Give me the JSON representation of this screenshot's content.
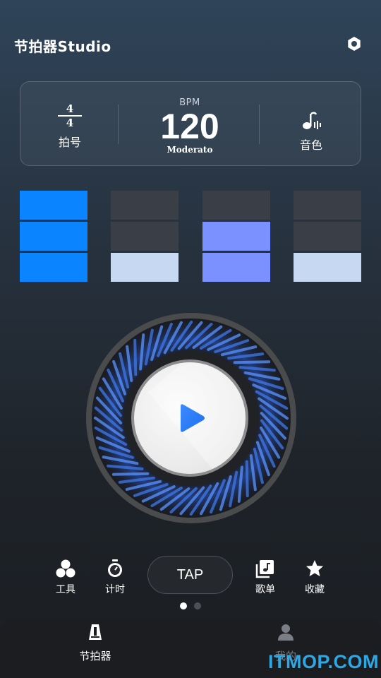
{
  "header": {
    "title": "节拍器Studio",
    "settings_icon": "gear-icon"
  },
  "panel": {
    "beat": {
      "numerator": "4",
      "denominator": "4",
      "label": "拍号"
    },
    "bpm": {
      "caption": "BPM",
      "value": "120",
      "tempo": "Moderato"
    },
    "tone": {
      "label": "音色",
      "icon": "music-note-icon"
    }
  },
  "beats": [
    {
      "blocks": [
        "#0a84ff",
        "#0a84ff",
        "#0a84ff"
      ]
    },
    {
      "blocks": [
        "#3a3f47",
        "#3a3f47",
        "#c7d9f2"
      ]
    },
    {
      "blocks": [
        "#3a3f47",
        "#7b91ff",
        "#7b91ff"
      ]
    },
    {
      "blocks": [
        "#3a3f47",
        "#3a3f47",
        "#c7d9f2"
      ]
    }
  ],
  "tools": {
    "tools_label": "工具",
    "timer_label": "计时",
    "tap_label": "TAP",
    "songlist_label": "歌单",
    "favorites_label": "收藏"
  },
  "pager": {
    "page": 1,
    "total": 2
  },
  "tabs": {
    "metronome_label": "节拍器",
    "mine_label": "我的"
  },
  "watermark": "ITMOP.COM",
  "colors": {
    "accent": "#0a84ff",
    "play": "#2f7cf6",
    "tab_inactive": "#7a7e85"
  }
}
